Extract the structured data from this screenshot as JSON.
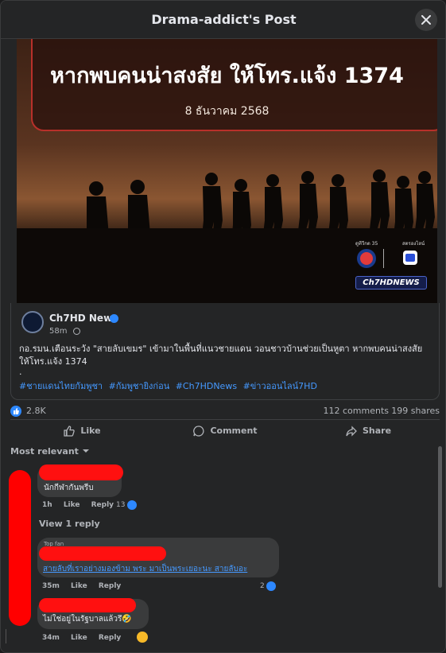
{
  "header": {
    "title": "Drama-addict's Post"
  },
  "media": {
    "headline": "หากพบคนน่าสงสัย ให้โทร.แจ้ง 1374",
    "date": "8 ธันวาคม 2568",
    "channel_label_a": "ดูทีวีกด 35",
    "channel_label_b": "สตรองไลน์",
    "news_tag": "Ch7HDNEWS"
  },
  "shared_post": {
    "page_name": "Ch7HD News",
    "time": "58m",
    "text": "กอ.รมน.เตือนระวัง \"สายลับเขมร\" เข้ามาในพื้นที่แนวชายแดน วอนชาวบ้านช่วยเป็นหูตา หากพบคนน่าสงสัย ให้โทร.แจ้ง 1374",
    "dot": ".",
    "hashtags": [
      "#ชายแดนไทยกัมพูชา",
      "#กัมพูชายิงก่อน",
      "#Ch7HDNews",
      "#ข่าวออนไลน์7HD"
    ]
  },
  "stats": {
    "reactions": "2.8K",
    "comments": "112 comments",
    "shares": "199 shares"
  },
  "actions": {
    "like": "Like",
    "comment": "Comment",
    "share": "Share"
  },
  "sort": {
    "label": "Most relevant"
  },
  "comments": [
    {
      "text": "นักกีฬากันพรีบ",
      "time": "1h",
      "like": "Like",
      "reply": "Reply",
      "reactions": "13"
    },
    {
      "badge": "Top fan",
      "text": "สายลับที่เราอย่างมองข้าม พระ มาเป็นพระเยอะนะ สายลับอะ",
      "time": "35m",
      "like": "Like",
      "reply": "Reply",
      "reactions": "2"
    },
    {
      "text": "ไม่ใช่อยู่ในรัฐบาลแล้วรึ🤣",
      "time": "34m",
      "like": "Like",
      "reply": "Reply"
    }
  ],
  "view_reply": "View 1 reply",
  "colors": {
    "background": "#242526",
    "accent": "#2d88ff",
    "redaction": "#ff0000",
    "hashtag": "#4599ff"
  }
}
